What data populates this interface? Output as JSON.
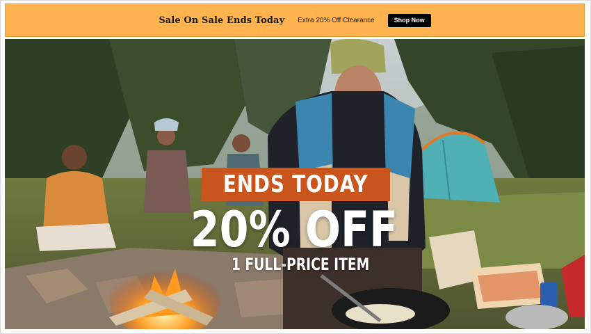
{
  "banner": {
    "title": "Sale On Sale Ends Today",
    "subtitle": "Extra 20% Off Clearance",
    "button_label": "Shop Now",
    "background_color": "#ffb34f"
  },
  "hero": {
    "badge_text": "ENDS TODAY",
    "badge_color": "#c9551c",
    "headline": "20% OFF",
    "subline": "1 FULL-PRICE ITEM",
    "image_subject": "campers cooking around a campfire in a forest with a teal tent"
  }
}
